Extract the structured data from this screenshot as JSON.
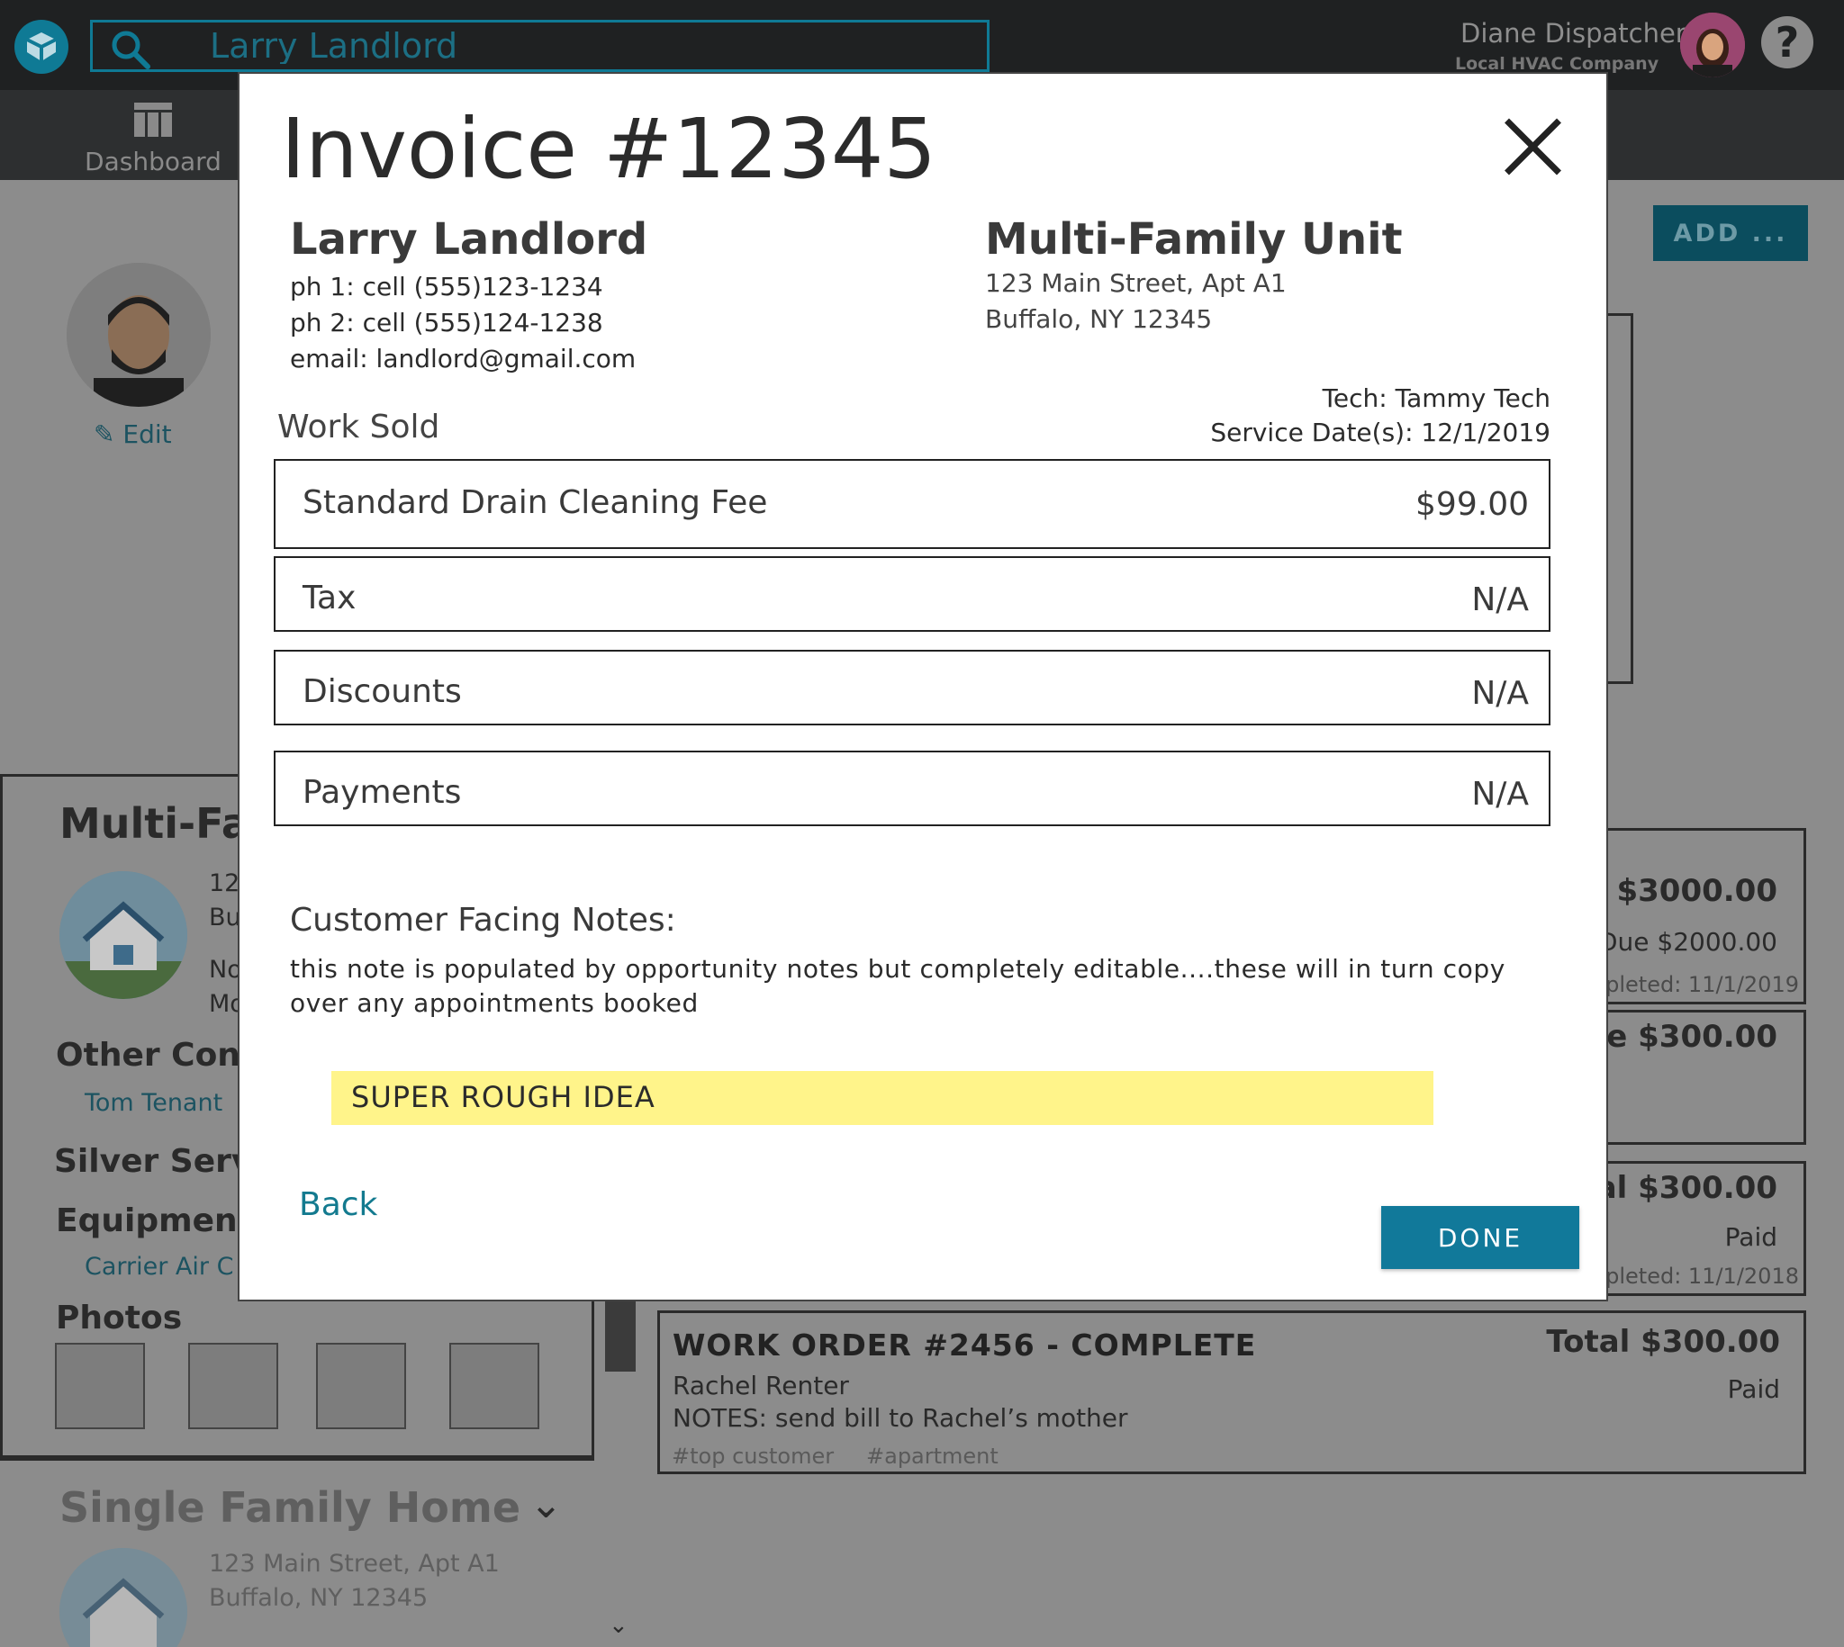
{
  "header": {
    "search_value": "Larry Landlord",
    "user_name": "Diane Dispatcher",
    "user_company": "Local HVAC Company",
    "help_symbol": "?"
  },
  "nav": {
    "dashboard_label": "Dashboard"
  },
  "background": {
    "add_label": "ADD ...",
    "edit_label": "Edit",
    "property_card": {
      "title_fragment": "Multi-Fa",
      "address_fragment_1": "12",
      "address_fragment_2": "Bu",
      "notes_fragment_1": "No",
      "notes_fragment_2": "Mo",
      "other_contacts_heading": "Other Cont",
      "other_contact": "Tom Tenant",
      "plan_heading": "Silver Servi",
      "equipment_heading": "Equipment",
      "equipment_item": "Carrier Air C",
      "photos_heading": "Photos"
    },
    "second_property": {
      "title": "Single Family Home",
      "address_line1": "123 Main Street, Apt A1",
      "address_line2": "Buffalo, NY 12345"
    },
    "work_orders": [
      {
        "total_fragment": "l $3000.00",
        "due_fragment": "Due $2000.00",
        "completed_fragment": "pleted: 11/1/2019"
      },
      {
        "total_fragment": "ue $300.00"
      },
      {
        "total_fragment": "tal $300.00",
        "status": "Paid",
        "completed_fragment": "pleted: 11/1/2018"
      },
      {
        "title": "WORK ORDER #2456 - COMPLETE",
        "customer": "Rachel Renter",
        "notes": "NOTES: send bill to Rachel’s mother",
        "tags": [
          "#top customer",
          "#apartment"
        ],
        "total": "Total $300.00",
        "status": "Paid"
      }
    ]
  },
  "invoice": {
    "title": "Invoice #12345",
    "customer": {
      "name": "Larry Landlord",
      "phone1": "ph 1: cell (555)123-1234",
      "phone2": "ph 2: cell (555)124-1238",
      "email": "email: landlord@gmail.com"
    },
    "property": {
      "name": "Multi-Family Unit",
      "address_line1": "123 Main Street, Apt A1",
      "address_line2": "Buffalo, NY 12345"
    },
    "tech": "Tech: Tammy Tech",
    "service_dates": "Service Date(s): 12/1/2019",
    "work_sold_label": "Work Sold",
    "line_items": [
      {
        "label": "Standard Drain Cleaning Fee",
        "value": "$99.00"
      },
      {
        "label": "Tax",
        "value": "N/A"
      },
      {
        "label": "Discounts",
        "value": "N/A"
      },
      {
        "label": "Payments",
        "value": "N/A"
      }
    ],
    "notes_heading": "Customer Facing Notes:",
    "notes_text": "this note is populated by opportunity notes but completely editable....these will in turn copy over any appointments booked",
    "banner": "SUPER ROUGH IDEA",
    "back_label": "Back",
    "done_label": "DONE"
  },
  "colors": {
    "accent": "#11799a",
    "banner": "#fff48a",
    "topbar": "#1f2122"
  }
}
